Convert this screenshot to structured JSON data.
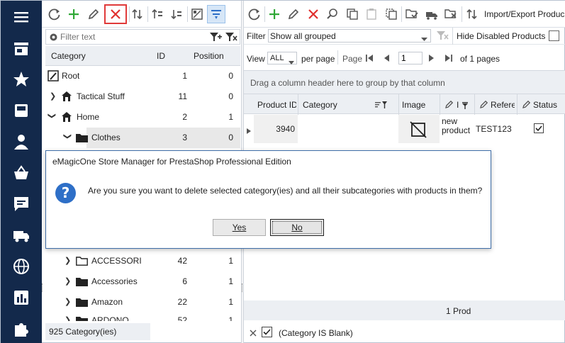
{
  "left_toolbar": {
    "filter_placeholder": "Filter text"
  },
  "tree": {
    "headers": {
      "category": "Category",
      "id": "ID",
      "position": "Position"
    },
    "rows_top": [
      {
        "name": "Root",
        "id": "1",
        "position": "0"
      },
      {
        "name": "Tactical Stuff",
        "id": "11",
        "position": "0"
      },
      {
        "name": "Home",
        "id": "2",
        "position": "1"
      },
      {
        "name": "Clothes",
        "id": "3",
        "position": "0"
      }
    ],
    "rows_bottom": [
      {
        "name": "ACCESSORI",
        "id": "42",
        "position": "1"
      },
      {
        "name": "Accessories",
        "id": "6",
        "position": "1"
      },
      {
        "name": "Amazon",
        "id": "22",
        "position": "1"
      },
      {
        "name": "ARDONO",
        "id": "52",
        "position": "1"
      }
    ],
    "footer_count": "925 Category(ies)"
  },
  "right_toolbar": {
    "import_export_label": "Import/Export Produc"
  },
  "filter_bar": {
    "filter_label": "Filter",
    "filter_value": "Show all grouped",
    "hide_disabled_label": "Hide Disabled Products"
  },
  "pager": {
    "view_label": "View",
    "view_value": "ALL",
    "per_page_label": "per page",
    "page_label": "Page",
    "page_value": "1",
    "of_pages": "of 1 pages"
  },
  "grid": {
    "group_hint": "Drag a column header here to group by that column",
    "headers": {
      "product_id": "Product ID",
      "category": "Category",
      "image": "Image",
      "name": "I",
      "reference": "Refere",
      "status": "Status"
    },
    "rows": [
      {
        "product_id": "3940",
        "category": "",
        "name_line1": "new",
        "name_line2": "product",
        "reference": "TEST123",
        "status_checked": true
      }
    ],
    "footer_count": "1 Prod",
    "filter_expr": "(Category IS Blank)"
  },
  "dialog": {
    "title": "eMagicOne Store Manager for PrestaShop Professional Edition",
    "message": "Are you sure you want to delete selected category(ies) and all their subcategories with products in them?",
    "yes_label": "Yes",
    "no_label": "No",
    "icon_glyph": "?"
  },
  "colors": {
    "nav_bg": "#13294b",
    "accent": "#2e6fc7",
    "add_green": "#2fa836",
    "delete_red": "#e0302e",
    "highlight_red": "#e03a3a"
  }
}
